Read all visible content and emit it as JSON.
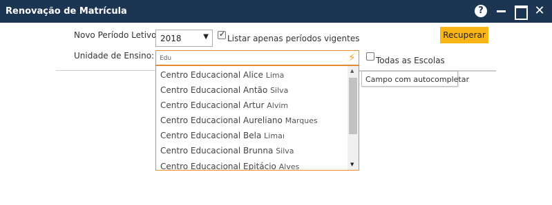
{
  "window": {
    "title": "Renovação de Matrícula",
    "help_glyph": "?",
    "close_glyph": "✕"
  },
  "form": {
    "periodo_label": "Novo Período Letivo:",
    "periodo_value": "2018",
    "listar_vigentes_label": "Listar apenas períodos vigentes",
    "listar_vigentes_checked": true,
    "unidade_label": "Unidade de Ensino:",
    "unidade_input_value": "Edu",
    "todas_escolas_label": "Todas as Escolas",
    "todas_escolas_checked": false,
    "recuperar_label": "Recuperar"
  },
  "dropdown": {
    "items": [
      {
        "name": "Centro Educacional Alice",
        "suffix": "Lima"
      },
      {
        "name": "Centro Educacional Antão",
        "suffix": "Silva"
      },
      {
        "name": "Centro Educacional Artur",
        "suffix": "Alvim"
      },
      {
        "name": "Centro Educacional Aureliano",
        "suffix": "Marques"
      },
      {
        "name": "Centro Educacional Bela",
        "suffix": "Limaı"
      },
      {
        "name": "Centro Educacional Brunna",
        "suffix": "Silva"
      },
      {
        "name": "Centro Educacional Epitácio",
        "suffix": "Alves"
      }
    ]
  },
  "tooltip": {
    "text": "Campo com autocompletar"
  },
  "colors": {
    "titlebar": "#1c3553",
    "accent_button": "#fcb517",
    "input_border": "#e8892e",
    "bolt": "#f5a623"
  }
}
